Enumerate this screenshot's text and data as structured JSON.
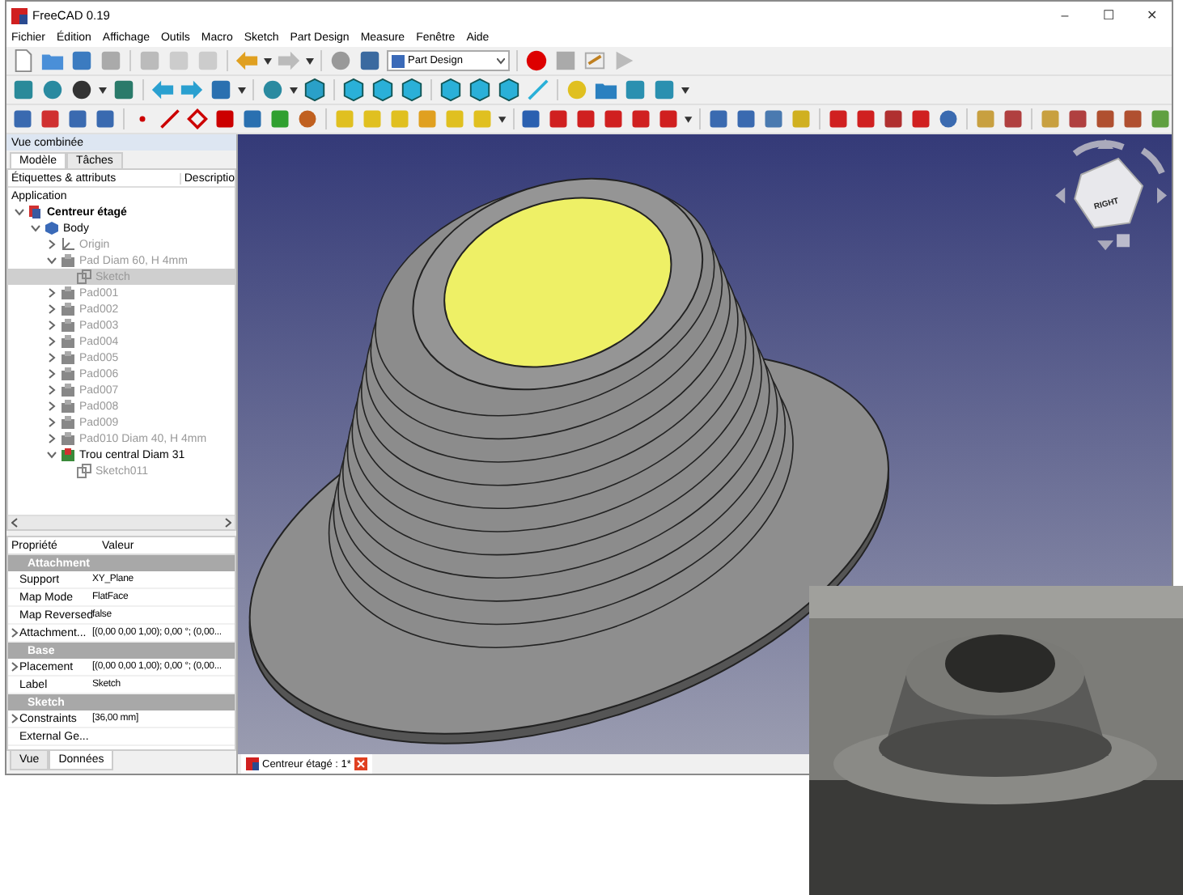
{
  "window": {
    "title": "FreeCAD 0.19",
    "controls": [
      "–",
      "☐",
      "✕"
    ]
  },
  "menu": [
    "Fichier",
    "Édition",
    "Affichage",
    "Outils",
    "Macro",
    "Sketch",
    "Part Design",
    "Measure",
    "Fenêtre",
    "Aide"
  ],
  "workbench": {
    "value": "Part Design"
  },
  "combo_view": {
    "title": "Vue combinée",
    "tabs": [
      {
        "label": "Modèle",
        "selected": true
      },
      {
        "label": "Tâches",
        "selected": false
      }
    ],
    "tree_columns": [
      "Étiquettes & attributs",
      "Descriptio"
    ],
    "tree_root": "Application",
    "tree": [
      {
        "label": "Centreur étagé",
        "kind": "document",
        "visible": true,
        "selected": false,
        "expanded": true,
        "children": [
          {
            "label": "Body",
            "kind": "body",
            "visible": true,
            "selected": false,
            "expanded": true,
            "children": [
              {
                "label": "Origin",
                "kind": "origin",
                "visible": false,
                "selected": false,
                "expanded": false
              },
              {
                "label": "Pad Diam 60, H 4mm",
                "kind": "pad",
                "visible": false,
                "selected": false,
                "expanded": true,
                "children": [
                  {
                    "label": "Sketch",
                    "kind": "sketch",
                    "visible": false,
                    "selected": true
                  }
                ]
              },
              {
                "label": "Pad001",
                "kind": "pad",
                "visible": false,
                "selected": false,
                "expanded": false
              },
              {
                "label": "Pad002",
                "kind": "pad",
                "visible": false,
                "selected": false,
                "expanded": false
              },
              {
                "label": "Pad003",
                "kind": "pad",
                "visible": false,
                "selected": false,
                "expanded": false
              },
              {
                "label": "Pad004",
                "kind": "pad",
                "visible": false,
                "selected": false,
                "expanded": false
              },
              {
                "label": "Pad005",
                "kind": "pad",
                "visible": false,
                "selected": false,
                "expanded": false
              },
              {
                "label": "Pad006",
                "kind": "pad",
                "visible": false,
                "selected": false,
                "expanded": false
              },
              {
                "label": "Pad007",
                "kind": "pad",
                "visible": false,
                "selected": false,
                "expanded": false
              },
              {
                "label": "Pad008",
                "kind": "pad",
                "visible": false,
                "selected": false,
                "expanded": false
              },
              {
                "label": "Pad009",
                "kind": "pad",
                "visible": false,
                "selected": false,
                "expanded": false
              },
              {
                "label": "Pad010 Diam 40, H 4mm",
                "kind": "pad",
                "visible": false,
                "selected": false,
                "expanded": false
              },
              {
                "label": "Trou central Diam 31",
                "kind": "pocket",
                "visible": true,
                "selected": false,
                "expanded": true,
                "children": [
                  {
                    "label": "Sketch011",
                    "kind": "sketch",
                    "visible": false,
                    "selected": false
                  }
                ]
              }
            ]
          }
        ]
      }
    ],
    "properties": {
      "columns": [
        "Propriété",
        "Valeur"
      ],
      "groups": [
        {
          "name": "Attachment",
          "rows": [
            {
              "name": "Support",
              "value": "XY_Plane",
              "expandable": false
            },
            {
              "name": "Map Mode",
              "value": "FlatFace",
              "expandable": false
            },
            {
              "name": "Map Reversed",
              "value": "false",
              "expandable": false
            },
            {
              "name": "Attachment...",
              "value": "[(0,00 0,00 1,00); 0,00 °; (0,00...",
              "expandable": true
            }
          ]
        },
        {
          "name": "Base",
          "rows": [
            {
              "name": "Placement",
              "value": "[(0,00 0,00 1,00); 0,00 °; (0,00...",
              "expandable": true
            },
            {
              "name": "Label",
              "value": "Sketch",
              "expandable": false
            }
          ]
        },
        {
          "name": "Sketch",
          "rows": [
            {
              "name": "Constraints",
              "value": "[36,00 mm]",
              "expandable": true
            },
            {
              "name": "External Ge...",
              "value": "",
              "expandable": false
            }
          ]
        }
      ]
    },
    "bottom_tabs": [
      {
        "label": "Vue",
        "selected": false
      },
      {
        "label": "Données",
        "selected": true
      }
    ]
  },
  "view3d": {
    "nav_cube_face": "RIGHT"
  },
  "document_tabs": [
    {
      "label": "Centreur étagé : 1*",
      "selected": true
    }
  ]
}
